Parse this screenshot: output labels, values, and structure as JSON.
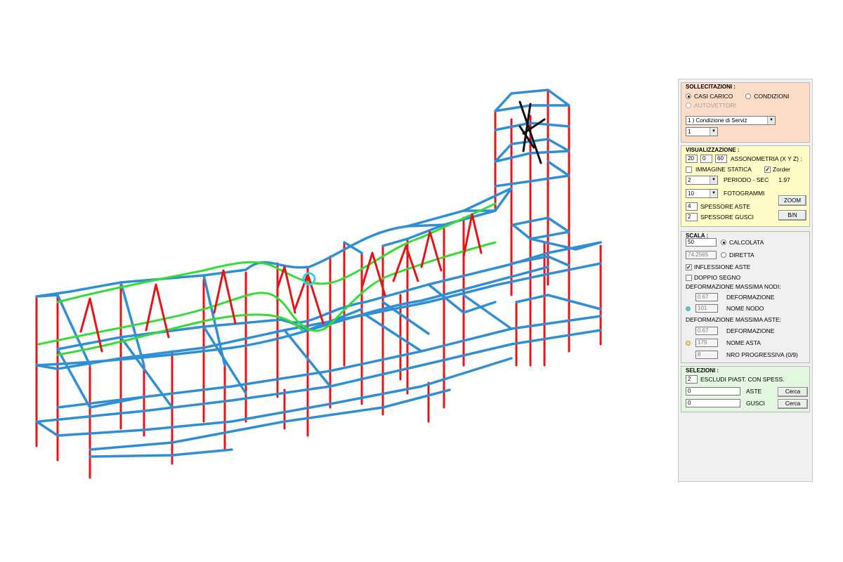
{
  "colors": {
    "beam": "#2f8fd6",
    "column": "#e81414",
    "deformed": "#33dd33",
    "bracing": "#111111",
    "group_sollecitazioni": "#fbdcc6",
    "group_visualizzazione": "#fffcc7",
    "group_scala": "#f0f0f0",
    "group_selezioni": "#e3f6df",
    "node_marker": "#33d0e8",
    "beam_marker": "#ffe844"
  },
  "sollecitazioni": {
    "title": "SOLLECITAZIONI :",
    "casi_carico": "CASI CARICO",
    "condizioni": "CONDIZIONI",
    "autovettori": "AUTOVETTORI",
    "condition_select": "1 ) Condizione di Serviz",
    "index_select": "1"
  },
  "visualizzazione": {
    "title": "VISUALIZZAZIONE :",
    "axon_x": "20",
    "axon_y": "0",
    "axon_z": "60",
    "axon_label": "ASSONOMETRIA (X Y Z) :",
    "immagine_statica": "IMMAGINE STATICA",
    "zorder": "Zorder",
    "periodo_select": "2",
    "periodo_label": "PERIODO - SEC",
    "periodo_value": "1.97",
    "fotogrammi_select": "10",
    "fotogrammi_label": "FOTOGRAMMI",
    "zoom_button": "ZOOM",
    "spessore_aste_value": "4",
    "spessore_aste_label": "SPESSORE ASTE",
    "spessore_gusci_value": "2",
    "spessore_gusci_label": "SPESSORE GUSCI",
    "bn_button": "B/N"
  },
  "scala": {
    "title": "SCALA :",
    "calcolata_value": "50",
    "calcolata_label": "CALCOLATA",
    "diretta_value": "74.2565",
    "diretta_label": "DIRETTA",
    "inflessione_aste": "INFLESSIONE ASTE",
    "doppio_segno": "DOPPIO SEGNO",
    "def_max_nodi": "DEFORMAZIONE MASSIMA NODI:",
    "nodi_deformazione_value": "0.67",
    "nodi_deformazione_label": "DEFORMAZIONE",
    "nome_nodo_value": "101",
    "nome_nodo_label": "NOME NODO",
    "def_max_aste": "DEFORMAZIONE MASSIMA ASTE:",
    "aste_deformazione_value": "0.67",
    "aste_deformazione_label": "DEFORMAZIONE",
    "nome_asta_value": "179",
    "nome_asta_label": "NOME ASTA",
    "nro_progressiva_value": "8",
    "nro_progressiva_label": "NRO PROGRESSIVA (0/9)"
  },
  "selezioni": {
    "title": "SELEZIONI :",
    "escludi_value": "2",
    "escludi_label": "ESCLUDI PIAST. CON SPESS.",
    "aste_value": "0",
    "aste_label": "ASTE",
    "gusci_value": "0",
    "gusci_label": "GUSCI",
    "cerca_button": "Cerca"
  }
}
